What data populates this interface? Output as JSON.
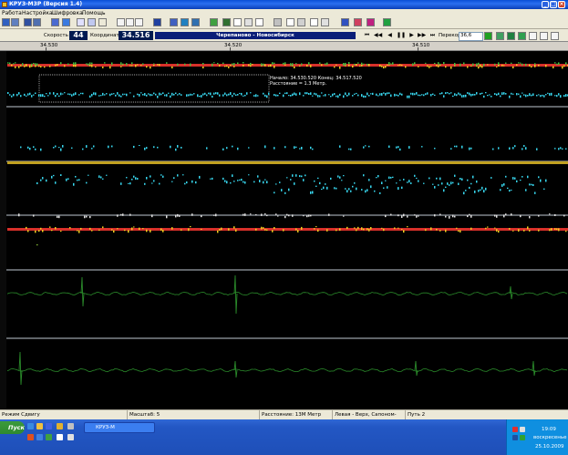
{
  "window": {
    "title": "КРУЗ-М3Р (Версия 1.4)"
  },
  "menu": [
    "Работа",
    "Настройка",
    "Шифровка",
    "Помощь"
  ],
  "toolbar2": {
    "speed_label": "Скорость",
    "speed_value": "44",
    "coord_label": "Координата",
    "coord_value": "34.516",
    "segment": "Черепаново - Новосибирск",
    "perekr_label": "Перекор",
    "perekr_value": "36,6"
  },
  "ruler": {
    "labels": [
      "34.530",
      "34.520",
      "34.510"
    ]
  },
  "selection": {
    "line1": "Начало: 34.530.520 Конец: 34.517.520",
    "line2": "Расстояние = 1.3 Метр."
  },
  "status": {
    "mode": "Режим Сдвигу",
    "scale": "Масштаб: 5",
    "distance": "Расстояние: 13М Метр",
    "direction": "Левая - Верх, Сапоном-вперёд",
    "path": "Путь 2"
  },
  "taskbar": {
    "start": "Пуск",
    "task": "КРУЗ-М",
    "time": "19:09",
    "day": "воскресенье",
    "date": "25.10.2009"
  },
  "colors": {
    "cyan": "#38d8f0",
    "green": "#2a8a2a",
    "red": "#e02020",
    "yellow": "#e8e020"
  }
}
